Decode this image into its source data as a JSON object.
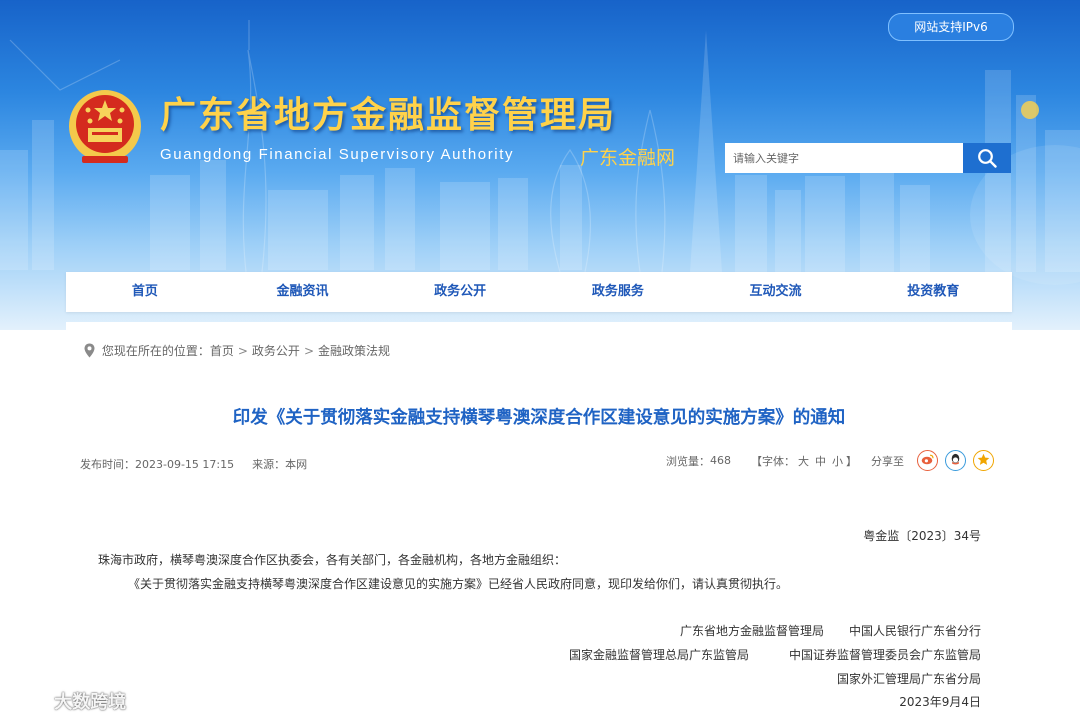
{
  "header": {
    "ipv6_badge": "网站支持IPv6",
    "site_title": "广东省地方金融监督管理局",
    "site_subtitle_en": "Guangdong Financial Supervisory Authority",
    "site_brand": "广东金融网",
    "search": {
      "placeholder": "请输入关键字"
    }
  },
  "nav": {
    "items": [
      {
        "label": "首页"
      },
      {
        "label": "金融资讯"
      },
      {
        "label": "政务公开"
      },
      {
        "label": "政务服务"
      },
      {
        "label": "互动交流"
      },
      {
        "label": "投资教育"
      }
    ]
  },
  "breadcrumb": {
    "prefix": "您现在所在的位置：",
    "items": [
      "首页",
      "政务公开",
      "金融政策法规"
    ],
    "separator": ">"
  },
  "article": {
    "title": "印发《关于贯彻落实金融支持横琴粤澳深度合作区建设意见的实施方案》的通知",
    "publish_time_label": "发布时间：",
    "publish_time": "2023-09-15 17:15",
    "source_label": "来源：",
    "source": "本网",
    "views_label": "浏览量：",
    "views": "468",
    "font_label": "【字体：",
    "font_sizes": [
      "大",
      "中",
      "小"
    ],
    "font_close": "】",
    "share_label": "分享至",
    "doc_number": "粤金监〔2023〕34号",
    "addressee": "珠海市政府，横琴粤澳深度合作区执委会，各有关部门，各金融机构，各地方金融组织：",
    "paragraph": "《关于贯彻落实金融支持横琴粤澳深度合作区建设意见的实施方案》已经省人民政府同意，现印发给你们，请认真贯彻执行。",
    "signatories": [
      "广东省地方金融监督管理局",
      "中国人民银行广东省分行",
      "国家金融监督管理总局广东监管局",
      "中国证券监督管理委员会广东监管局",
      "国家外汇管理局广东省分局"
    ],
    "date": "2023年9月4日"
  },
  "watermark": "大数跨境",
  "colors": {
    "header_blue": "#1763c9",
    "title_gold": "#ffd24a",
    "nav_text": "#1f58b8",
    "article_title": "#1f63c4",
    "weibo": "#e8603c",
    "qq": "#3a9bdc",
    "favorite": "#f0a500"
  },
  "icons": [
    "national-emblem-icon",
    "search-icon",
    "location-pin-icon",
    "weibo-icon",
    "qq-icon",
    "favorite-star-icon"
  ]
}
